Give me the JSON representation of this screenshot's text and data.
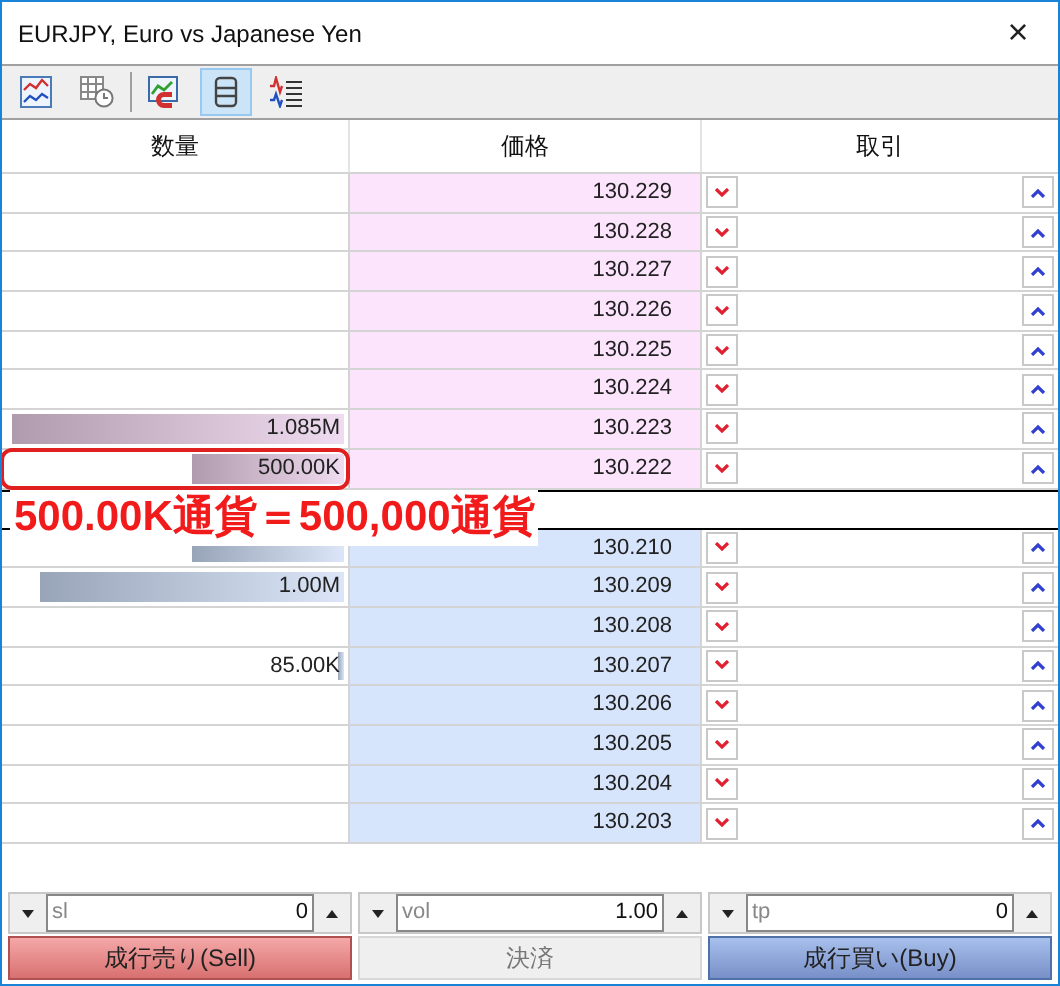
{
  "window": {
    "title": "EURJPY, Euro vs Japanese Yen",
    "close": "×"
  },
  "toolbar": [
    {
      "kind": "chart",
      "selected": false
    },
    {
      "kind": "history",
      "selected": false
    },
    {
      "kind": "magnet",
      "selected": false
    },
    {
      "kind": "depth",
      "selected": true
    },
    {
      "kind": "ticks",
      "selected": false
    }
  ],
  "columns": [
    "数量",
    "価格",
    "取引"
  ],
  "asks": [
    {
      "price": "130.229"
    },
    {
      "price": "130.228"
    },
    {
      "price": "130.227"
    },
    {
      "price": "130.226"
    },
    {
      "price": "130.225"
    },
    {
      "price": "130.224"
    },
    {
      "price": "130.223",
      "volume": "1.085M",
      "level": 0.985
    },
    {
      "price": "130.222",
      "volume": "500.00K",
      "level": 0.45,
      "highlighted": true
    }
  ],
  "annotation": "500.00K通貨＝500,000通貨",
  "bids": [
    {
      "price": "130.210",
      "level": 0.45
    },
    {
      "price": "130.209",
      "volume": "1.00M",
      "level": 0.9
    },
    {
      "price": "130.208"
    },
    {
      "price": "130.207",
      "volume": "85.00K",
      "level": 0.02
    },
    {
      "price": "130.206"
    },
    {
      "price": "130.205"
    },
    {
      "price": "130.204"
    },
    {
      "price": "130.203"
    }
  ],
  "fields": [
    {
      "label": "sl",
      "value": "0"
    },
    {
      "label": "vol",
      "value": "1.00"
    },
    {
      "label": "tp",
      "value": "0"
    }
  ],
  "buttons": [
    {
      "kind": "sell",
      "label": "成行売り(Sell)",
      "disabled": false
    },
    {
      "kind": "close",
      "label": "決済",
      "disabled": true
    },
    {
      "kind": "buy",
      "label": "成行買い(Buy)",
      "disabled": false
    }
  ]
}
